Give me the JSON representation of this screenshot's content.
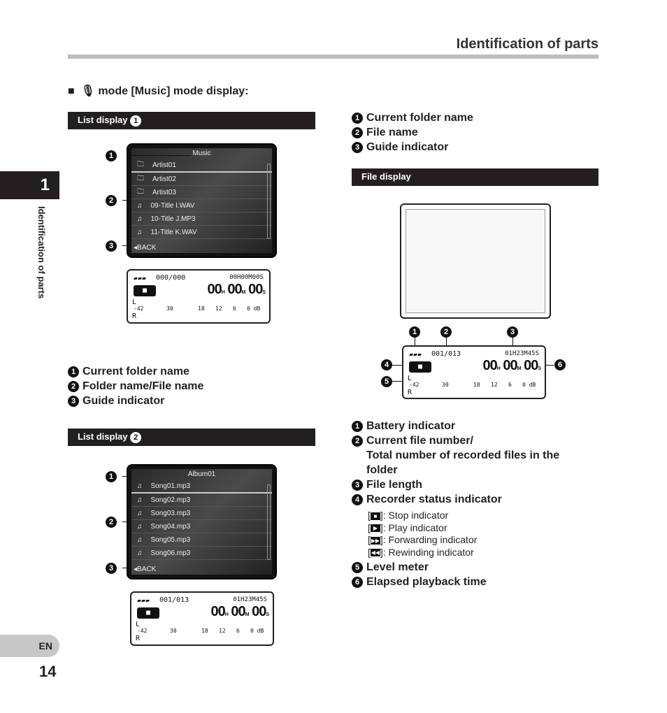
{
  "header": {
    "title": "Identification of parts"
  },
  "section": {
    "title": "mode [Music] mode display:",
    "icon": "microphone-icon"
  },
  "side": {
    "chapter": "1",
    "label": "Identification of parts",
    "lang": "EN",
    "page": "14"
  },
  "list1": {
    "bar": "List display",
    "bar_num": "1",
    "title": "Music",
    "items": [
      {
        "icon": "folder",
        "label": "Artist01"
      },
      {
        "icon": "folder",
        "label": "Artist02"
      },
      {
        "icon": "folder",
        "label": "Artist03"
      },
      {
        "icon": "music",
        "label": "09-Title I.WAV"
      },
      {
        "icon": "music",
        "label": "10-Title J.MP3"
      },
      {
        "icon": "music",
        "label": "11-Title K.WAV"
      }
    ],
    "back": "BACK",
    "legend": [
      {
        "n": "1",
        "t": "Current folder name"
      },
      {
        "n": "2",
        "t": "Folder name/File name"
      },
      {
        "n": "3",
        "t": "Guide indicator"
      }
    ]
  },
  "list2": {
    "bar": "List display",
    "bar_num": "2",
    "title": "Album01",
    "items": [
      {
        "icon": "music",
        "label": "Song01.mp3"
      },
      {
        "icon": "music",
        "label": "Song02.mp3"
      },
      {
        "icon": "music",
        "label": "Song03.mp3"
      },
      {
        "icon": "music",
        "label": "Song04.mp3"
      },
      {
        "icon": "music",
        "label": "Song05.mp3"
      },
      {
        "icon": "music",
        "label": "Song06.mp3"
      }
    ],
    "back": "BACK",
    "legend": [
      {
        "n": "1",
        "t": "Current folder name"
      },
      {
        "n": "2",
        "t": "File name"
      },
      {
        "n": "3",
        "t": "Guide indicator"
      }
    ]
  },
  "lcd1": {
    "count": "000/000",
    "length": "00H00M00S",
    "h": "00",
    "m": "00",
    "s": "00",
    "scale": [
      "-42",
      "30",
      "18",
      "12",
      "6",
      "0 dB"
    ]
  },
  "lcd2": {
    "count": "001/013",
    "length": "01H23M45S",
    "h": "00",
    "m": "00",
    "s": "00",
    "scale": [
      "-42",
      "30",
      "18",
      "12",
      "6",
      "0 dB"
    ]
  },
  "lcd3": {
    "count": "001/013",
    "length": "01H23M45S",
    "h": "00",
    "m": "00",
    "s": "00",
    "scale": [
      "-42",
      "30",
      "18",
      "12",
      "6",
      "0 dB"
    ]
  },
  "file": {
    "bar": "File display",
    "legend": [
      {
        "n": "1",
        "t": "Battery indicator"
      },
      {
        "n": "2",
        "t": "Current file number/"
      },
      {
        "n": "",
        "t": "Total number of recorded files in the"
      },
      {
        "n": "",
        "t": "folder"
      },
      {
        "n": "3",
        "t": "File length"
      },
      {
        "n": "4",
        "t": "Recorder status indicator"
      }
    ],
    "indicators": [
      {
        "g": "■",
        "t": ": Stop indicator"
      },
      {
        "g": "▶",
        "t": ": Play indicator"
      },
      {
        "g": "▶▶",
        "t": ": Forwarding indicator"
      },
      {
        "g": "◀◀",
        "t": ": Rewinding indicator"
      }
    ],
    "legend2": [
      {
        "n": "5",
        "t": "Level meter"
      },
      {
        "n": "6",
        "t": "Elapsed playback time"
      }
    ]
  }
}
